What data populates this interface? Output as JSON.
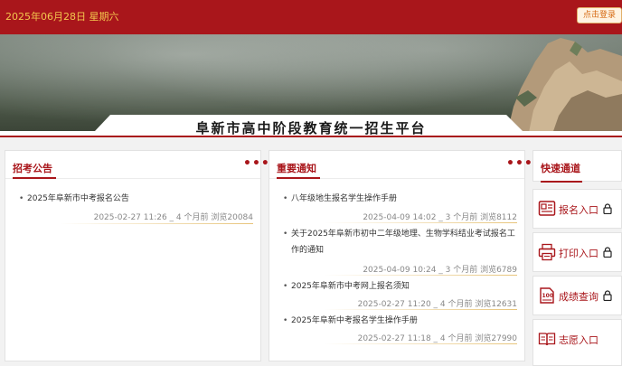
{
  "topbar": {
    "date": "2025年06月28日 星期六",
    "login_label": "点击登录"
  },
  "banner": {
    "title": "阜新市高中阶段教育统一招生平台"
  },
  "announcements": {
    "title": "招考公告",
    "more": "•••",
    "items": [
      {
        "text": "2025年阜新市中考报名公告",
        "meta": "2025-02-27 11:26 _ 4 个月前 浏览20084"
      }
    ]
  },
  "notices": {
    "title": "重要通知",
    "more": "•••",
    "items": [
      {
        "text": "八年级地生报名学生操作手册",
        "meta": "2025-04-09 14:02 _ 3 个月前 浏览8112"
      },
      {
        "text_line1": "关于2025年阜新市初中二年级地理、生物学科结业考试报名工",
        "text_line2": "作的通知",
        "meta": "2025-04-09 10:24 _ 3 个月前 浏览6789"
      },
      {
        "text": "2025年阜新市中考网上报名须知",
        "meta": "2025-02-27 11:20 _ 4 个月前 浏览12631"
      },
      {
        "text": "2025年阜新中考报名学生操作手册",
        "meta": "2025-02-27 11:18 _ 4 个月前 浏览27990"
      }
    ]
  },
  "quick": {
    "title": "快速通道",
    "entries": [
      {
        "label": "报名入口",
        "icon": "registration-form-icon",
        "locked": true
      },
      {
        "label": "打印入口",
        "icon": "printer-icon",
        "locked": true
      },
      {
        "label": "成绩查询",
        "icon": "score-sheet-icon",
        "locked": true
      },
      {
        "label": "志愿入口",
        "icon": "open-book-icon",
        "locked": false
      }
    ]
  },
  "colors": {
    "brand_red": "#a9161b",
    "date_gold": "#f3c64e",
    "meta_line": "#e7c47a"
  }
}
